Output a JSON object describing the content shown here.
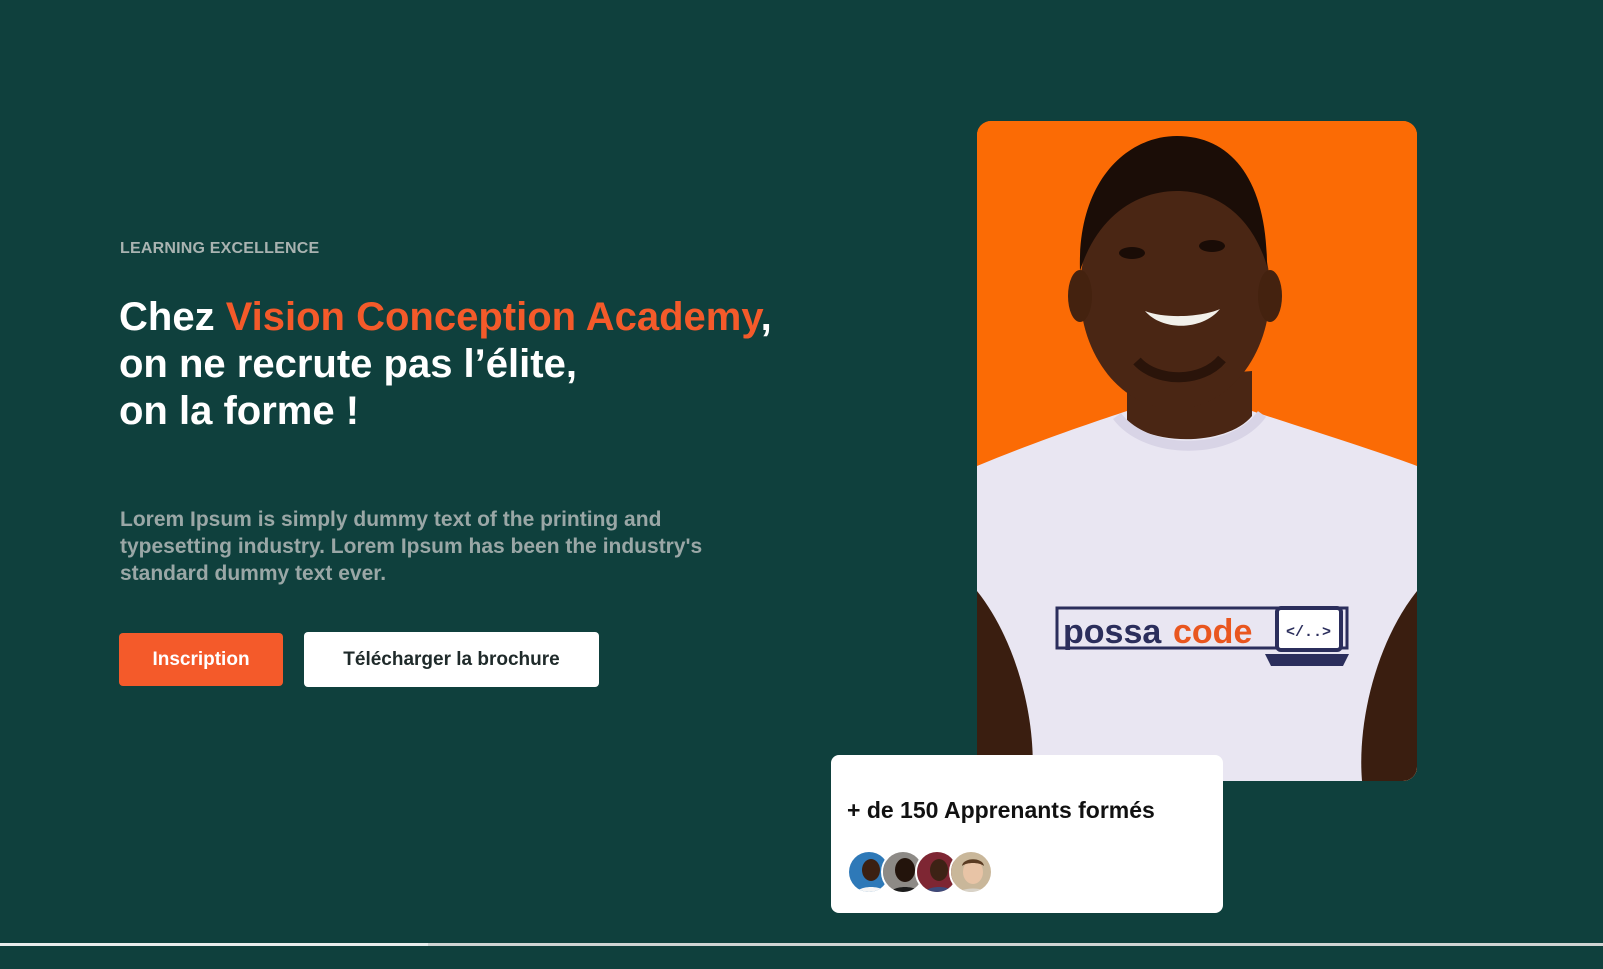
{
  "hero": {
    "eyebrow": "LEARNING EXCELLENCE",
    "headline": {
      "prefix": "Chez ",
      "accent": "Vision Conception Academy",
      "suffix": ",",
      "line2": "on ne recrute pas l’élite,",
      "line3": "on la forme !"
    },
    "description": "Lorem Ipsum is simply dummy text of the printing and typesetting industry. Lorem Ipsum has been the industry's standard dummy text ever.",
    "buttons": {
      "primary": "Inscription",
      "secondary": "Télécharger la brochure"
    }
  },
  "photo": {
    "shirt_logo_text_1": "possa",
    "shirt_logo_text_2": "code",
    "shirt_logo_code": "</..>"
  },
  "stats": {
    "title": "+ de 150 Apprenants formés",
    "avatars": [
      "student-1",
      "student-2",
      "student-3",
      "student-4"
    ]
  },
  "colors": {
    "background": "#0f403d",
    "accent": "#f45a2a",
    "photo_bg": "#fb6b05"
  }
}
